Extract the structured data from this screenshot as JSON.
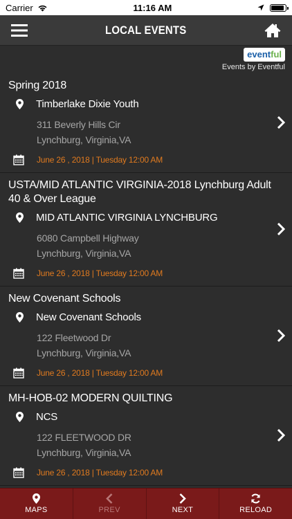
{
  "status_bar": {
    "carrier": "Carrier",
    "time": "11:16 AM",
    "battery_level": 0.9
  },
  "nav": {
    "title": "LOCAL EVENTS"
  },
  "brand": {
    "logo_a": "event",
    "logo_b": "ful",
    "caption": "Events by Eventful"
  },
  "events": [
    {
      "title": "Spring 2018",
      "venue": "Timberlake Dixie Youth",
      "address1": "311 Beverly Hills Cir",
      "address2": "Lynchburg, Virginia,VA",
      "date": "June 26 , 2018 | Tuesday 12:00 AM"
    },
    {
      "title": "USTA/MID ATLANTIC VIRGINIA-2018 Lynchburg Adult 40 & Over League",
      "venue": "MID ATLANTIC VIRGINIA LYNCHBURG",
      "address1": "6080 Campbell Highway",
      "address2": "Lynchburg, Virginia,VA",
      "date": "June 26 , 2018 | Tuesday 12:00 AM"
    },
    {
      "title": "New Covenant Schools",
      "venue": "New Covenant Schools",
      "address1": "122 Fleetwood Dr",
      "address2": "Lynchburg, Virginia,VA",
      "date": "June 26 , 2018 | Tuesday 12:00 AM"
    },
    {
      "title": "MH-HOB-02 MODERN QUILTING",
      "venue": "NCS",
      "address1": "122 FLEETWOOD DR",
      "address2": "Lynchburg, Virginia,VA",
      "date": "June 26 , 2018 | Tuesday 12:00 AM"
    }
  ],
  "tabs": [
    {
      "label": "MAPS",
      "icon": "map-pin-icon"
    },
    {
      "label": "PREV",
      "icon": "chevron-left-icon"
    },
    {
      "label": "NEXT",
      "icon": "chevron-right-icon"
    },
    {
      "label": "RELOAD",
      "icon": "reload-icon"
    }
  ],
  "colors": {
    "accent_date": "#e07a1f",
    "tab_bar": "#7a1a1a",
    "background": "#2d2d2d"
  }
}
